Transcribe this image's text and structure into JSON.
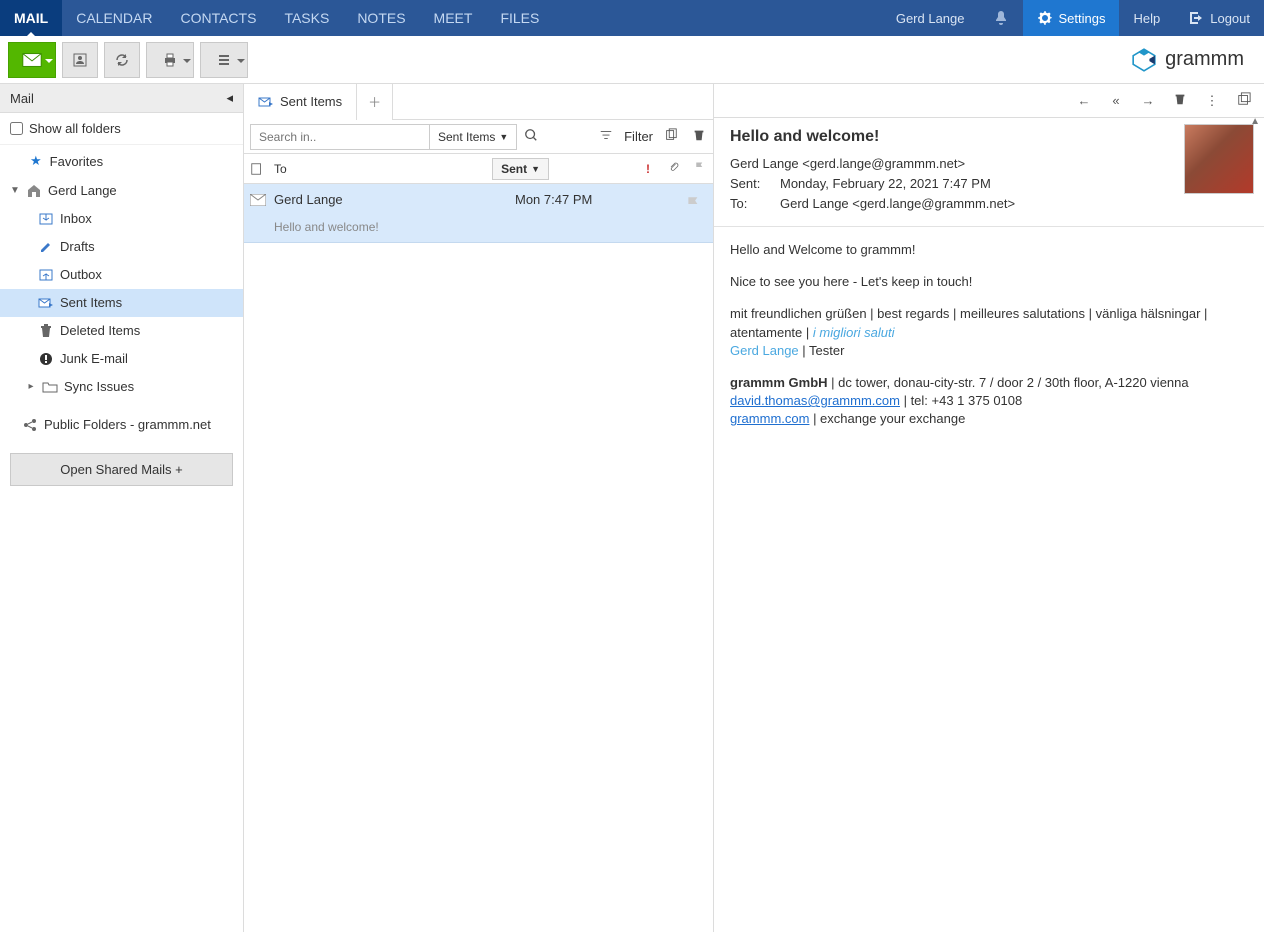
{
  "topnav": {
    "items": [
      "MAIL",
      "CALENDAR",
      "CONTACTS",
      "TASKS",
      "NOTES",
      "MEET",
      "FILES"
    ],
    "active": 0,
    "user": "Gerd Lange",
    "settings": "Settings",
    "help": "Help",
    "logout": "Logout"
  },
  "brand": "grammm",
  "sidebar": {
    "title": "Mail",
    "show_all": "Show all folders",
    "favorites": "Favorites",
    "account": "Gerd Lange",
    "folders": [
      {
        "label": "Inbox",
        "icon": "inbox"
      },
      {
        "label": "Drafts",
        "icon": "draft"
      },
      {
        "label": "Outbox",
        "icon": "outbox"
      },
      {
        "label": "Sent Items",
        "icon": "sent",
        "selected": true
      },
      {
        "label": "Deleted Items",
        "icon": "trash"
      },
      {
        "label": "Junk E-mail",
        "icon": "junk"
      },
      {
        "label": "Sync Issues",
        "icon": "folder",
        "expandable": true
      }
    ],
    "public_folders": "Public Folders - grammm.net",
    "open_shared": "Open Shared Mails +"
  },
  "list": {
    "tab_label": "Sent Items",
    "search_placeholder": "Search in..",
    "search_scope": "Sent Items",
    "filter_label": "Filter",
    "col_to": "To",
    "col_sort": "Sent",
    "messages": [
      {
        "to": "Gerd Lange",
        "date": "Mon 7:47 PM",
        "subject": "Hello and welcome!"
      }
    ]
  },
  "preview": {
    "subject": "Hello and welcome!",
    "from": "Gerd Lange <gerd.lange@grammm.net>",
    "sent_label": "Sent:",
    "sent_value": "Monday, February 22, 2021 7:47 PM",
    "to_label": "To:",
    "to_value": "Gerd Lange <gerd.lange@grammm.net>",
    "body_line1": "Hello and Welcome to grammm!",
    "body_line2": "Nice to see you here - Let's keep in touch!",
    "sig_greet": "mit freundlichen grüßen | best regards | meilleures salutations | vänliga hälsningar | atentamente | ",
    "sig_greet_italic": "i migliori saluti",
    "sig_name": "Gerd Lange",
    "sig_title": " | Tester",
    "company": "grammm GmbH",
    "addr": " | dc tower, donau-city-str. 7 / door 2 / 30th floor, A-1220 vienna",
    "email_link": "david.thomas@grammm.com",
    "tel": " |  tel: +43 1 375 0108",
    "web": "grammm.com",
    "tagline": " | exchange your exchange"
  }
}
